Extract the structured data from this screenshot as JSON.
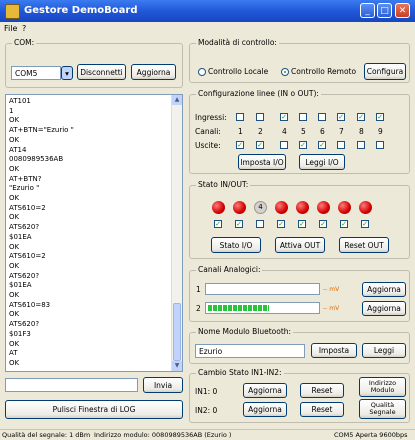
{
  "window": {
    "title": "Gestore DemoBoard"
  },
  "menu": [
    "File",
    "?"
  ],
  "com": {
    "label": "COM:",
    "port": "COM5",
    "disconnect": "Disconnetti",
    "refresh": "Aggiorna"
  },
  "log": {
    "lines": [
      "AT101",
      "1",
      "OK",
      "AT+BTN=\"Ezurio \"",
      "OK",
      "AT14",
      "0080989536AB",
      "OK",
      "AT+BTN?",
      "\"Ezurio \"",
      "OK",
      "ATS610=2",
      "OK",
      "ATS620?",
      "$01EA",
      "OK",
      "ATS610=2",
      "OK",
      "ATS620?",
      "$01EA",
      "OK",
      "ATS610=83",
      "OK",
      "ATS620?",
      "$01F3",
      "OK",
      "AT",
      "OK"
    ],
    "send_value": "",
    "send_button": "Invia",
    "clear_button": "Pulisci Finestra di LOG"
  },
  "control_mode": {
    "label": "Modalità di controllo:",
    "local": "Controllo Locale",
    "remote": "Controllo Remoto",
    "selected": "remote",
    "configure": "Configura"
  },
  "lines_config": {
    "label": "Configurazione linee (IN o OUT):",
    "inputs_label": "Ingressi:",
    "channels_label": "Canali:",
    "outputs_label": "Uscite:",
    "channels": [
      "1",
      "2",
      "4",
      "5",
      "6",
      "7",
      "8",
      "9"
    ],
    "inputs": [
      false,
      false,
      true,
      false,
      false,
      true,
      true,
      true
    ],
    "outputs": [
      true,
      true,
      false,
      true,
      true,
      false,
      false,
      false
    ],
    "set_button": "Imposta I/O",
    "read_button": "Leggi I/O"
  },
  "io_state": {
    "label": "Stato IN/OUT:",
    "leds": [
      "on",
      "on",
      "off",
      "on",
      "on",
      "on",
      "on",
      "on"
    ],
    "off_led_text": "4",
    "checks": [
      true,
      true,
      false,
      true,
      true,
      true,
      true,
      true
    ],
    "state_button": "Stato I/O",
    "activate_button": "Attiva OUT",
    "reset_button": "Reset OUT"
  },
  "analog": {
    "label": "Canali Analogici:",
    "ch1": {
      "name": "1",
      "level": 0.0,
      "readout": "-- mV",
      "button": "Aggiorna"
    },
    "ch2": {
      "name": "2",
      "level": 0.55,
      "readout": "-- mV",
      "button": "Aggiorna"
    }
  },
  "bt_name": {
    "label": "Nome Modulo Bluetooth:",
    "value": "Ezurio",
    "set_button": "Imposta",
    "read_button": "Leggi"
  },
  "state_change": {
    "label": "Cambio Stato IN1-IN2:",
    "in1_label": "IN1: 0",
    "in2_label": "IN2: 0",
    "update1": "Aggiorna",
    "reset1": "Reset",
    "update2": "Aggiorna",
    "reset2": "Reset",
    "module_addr_button": "Indirizzo\nModulo",
    "signal_quality_button": "Qualità\nSegnale"
  },
  "status": {
    "signal": "Qualità del segnale: 1 dBm",
    "address": "Indirizzo modulo: 0080989536AB (Ezurio )",
    "port": "COM5 Aperta 9600bps"
  }
}
